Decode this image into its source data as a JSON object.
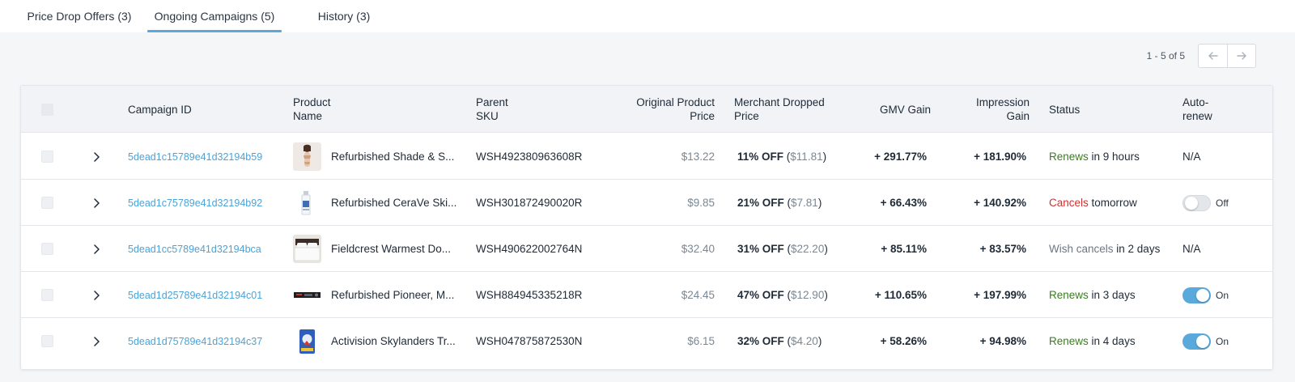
{
  "tabs": [
    {
      "label": "Price Drop Offers (3)",
      "active": false
    },
    {
      "label": "Ongoing Campaigns (5)",
      "active": true
    },
    {
      "label": "History (3)",
      "active": false
    }
  ],
  "pagination": {
    "range": "1 - 5 of 5"
  },
  "columns": {
    "campaign_id": "Campaign ID",
    "product_name": [
      "Product",
      "Name"
    ],
    "parent_sku": [
      "Parent",
      "SKU"
    ],
    "original_price": [
      "Original Product",
      "Price"
    ],
    "dropped_price": [
      "Merchant Dropped",
      "Price"
    ],
    "gmv_gain": "GMV Gain",
    "impression_gain": [
      "Impression",
      "Gain"
    ],
    "status": "Status",
    "auto_renew": [
      "Auto-",
      "renew"
    ]
  },
  "rows": [
    {
      "campaign_id": "5dead1c15789e41d32194b59",
      "product_name": "Refurbished Shade & S...",
      "thumb": "swimsuit",
      "parent_sku": "WSH492380963608R",
      "original_price": "$13.22",
      "drop_pct": "11% OFF",
      "drop_price": "$11.81",
      "gmv_gain": "+ 291.77%",
      "impression_gain": "+ 181.90%",
      "status_key": "Renews",
      "status_color": "#3a7d1e",
      "status_rest": " in 9 hours",
      "auto_renew": "N/A",
      "auto_renew_type": "na"
    },
    {
      "campaign_id": "5dead1c75789e41d32194b92",
      "product_name": "Refurbished CeraVe Ski...",
      "thumb": "bottle",
      "parent_sku": "WSH301872490020R",
      "original_price": "$9.85",
      "drop_pct": "21% OFF",
      "drop_price": "$7.81",
      "gmv_gain": "+ 66.43%",
      "impression_gain": "+ 140.92%",
      "status_key": "Cancels",
      "status_color": "#d32f2f",
      "status_rest": " tomorrow",
      "auto_renew": "Off",
      "auto_renew_type": "off"
    },
    {
      "campaign_id": "5dead1cc5789e41d32194bca",
      "product_name": "Fieldcrest Warmest Do...",
      "thumb": "bedding",
      "parent_sku": "WSH490622002764N",
      "original_price": "$32.40",
      "drop_pct": "31% OFF",
      "drop_price": "$22.20",
      "gmv_gain": "+ 85.11%",
      "impression_gain": "+ 83.57%",
      "status_key": "Wish cancels",
      "status_color": "#6b7784",
      "status_rest": " in 2 days",
      "auto_renew": "N/A",
      "auto_renew_type": "na"
    },
    {
      "campaign_id": "5dead1d25789e41d32194c01",
      "product_name": "Refurbished Pioneer, M...",
      "thumb": "stereo",
      "parent_sku": "WSH884945335218R",
      "original_price": "$24.45",
      "drop_pct": "47% OFF",
      "drop_price": "$12.90",
      "gmv_gain": "+ 110.65%",
      "impression_gain": "+ 197.99%",
      "status_key": "Renews",
      "status_color": "#3a7d1e",
      "status_rest": " in 3 days",
      "auto_renew": "On",
      "auto_renew_type": "on"
    },
    {
      "campaign_id": "5dead1d75789e41d32194c37",
      "product_name": "Activision Skylanders Tr...",
      "thumb": "toy",
      "parent_sku": "WSH047875872530N",
      "original_price": "$6.15",
      "drop_pct": "32% OFF",
      "drop_price": "$4.20",
      "gmv_gain": "+ 58.26%",
      "impression_gain": "+ 94.98%",
      "status_key": "Renews",
      "status_color": "#3a7d1e",
      "status_rest": " in 4 days",
      "auto_renew": "On",
      "auto_renew_type": "on"
    }
  ],
  "colors": {
    "accent": "#5aa9dc",
    "link": "#4aa3d8",
    "renews": "#3a7d1e",
    "cancels": "#d32f2f"
  }
}
